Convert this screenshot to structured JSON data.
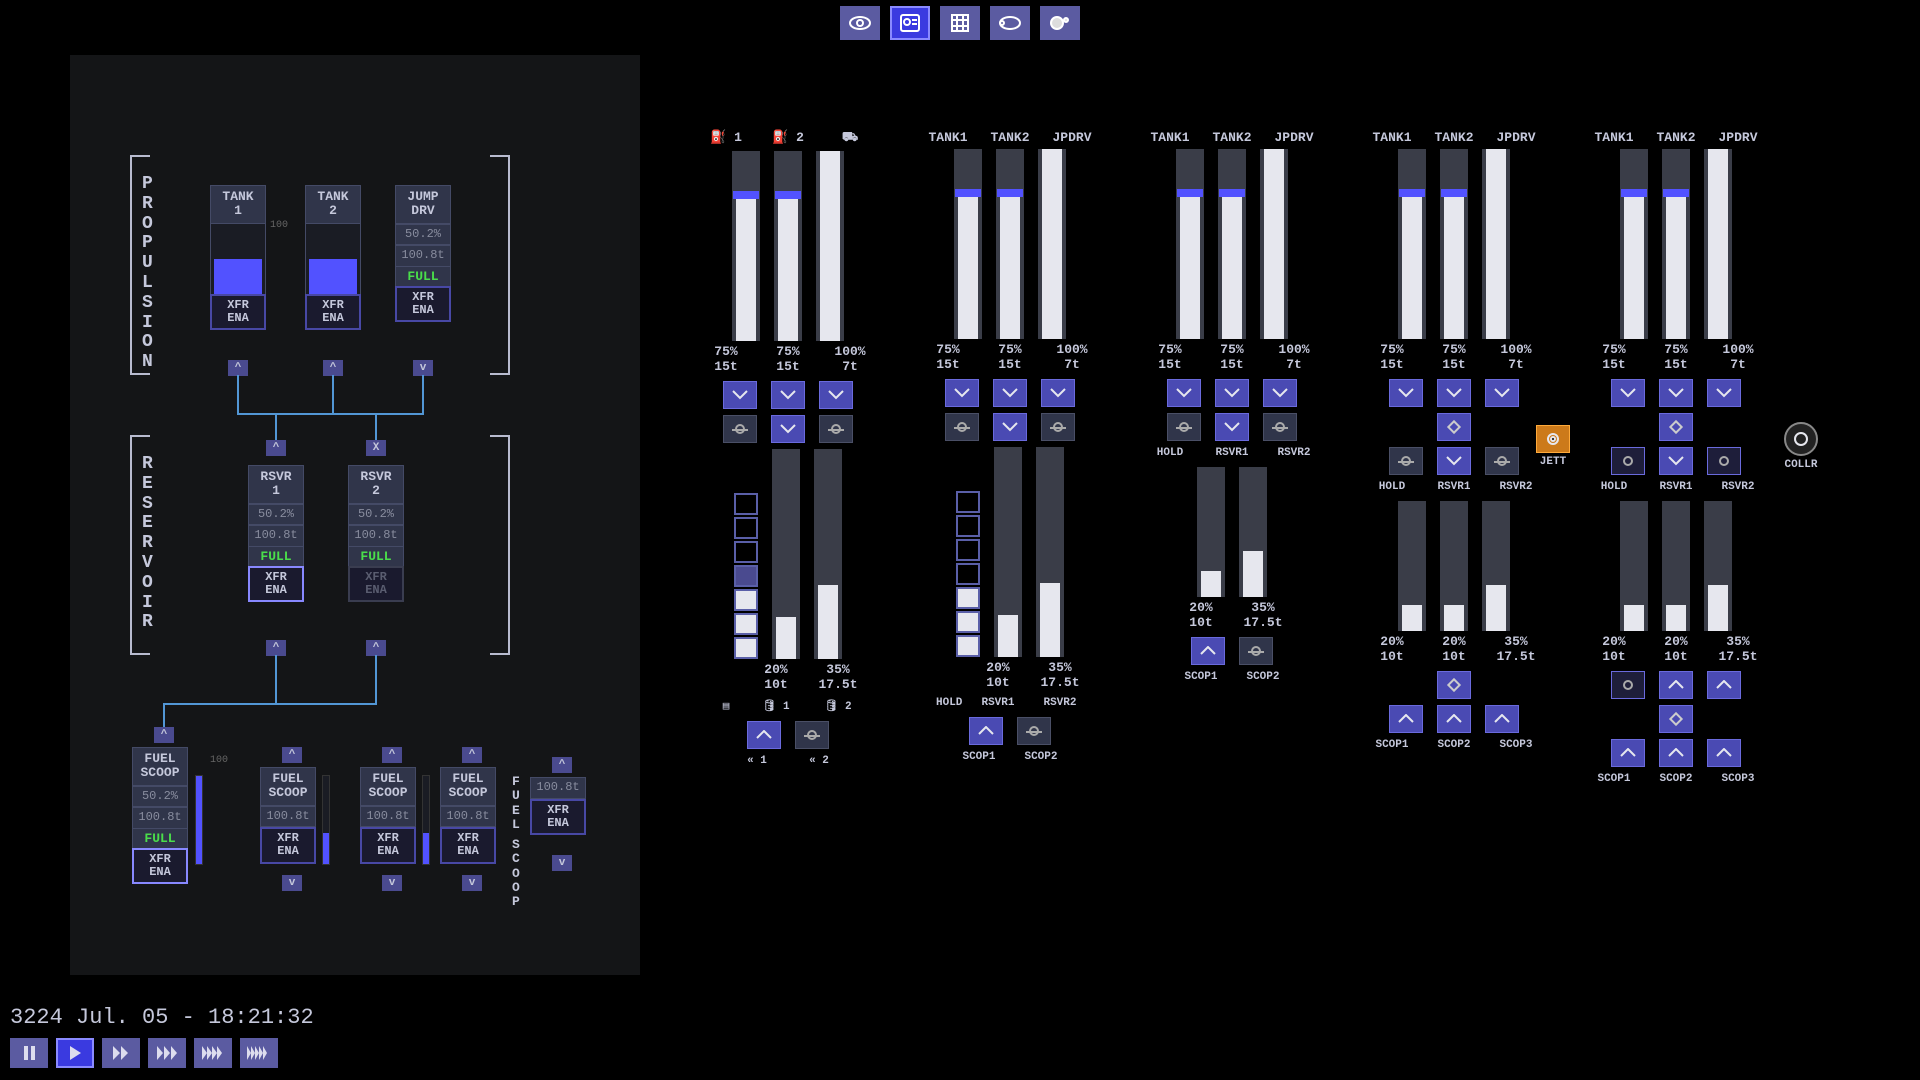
{
  "topnav": [
    {
      "name": "view-icon",
      "active": false,
      "glyph": "eye"
    },
    {
      "name": "profile-icon",
      "active": true,
      "glyph": "id"
    },
    {
      "name": "grid-icon",
      "active": false,
      "glyph": "grid"
    },
    {
      "name": "orbit-icon",
      "active": false,
      "glyph": "orbit"
    },
    {
      "name": "planet-icon",
      "active": false,
      "glyph": "planet"
    }
  ],
  "leftpanel": {
    "propulsion": {
      "label": "PROPULSION",
      "tanks": [
        {
          "title": "TANK\n1",
          "fill": 50,
          "xfr": "XFR\nENA",
          "xfr_highlight": false,
          "show_gauge": true
        },
        {
          "title": "TANK\n2",
          "fill": 50,
          "xfr": "XFR\nENA",
          "xfr_highlight": false,
          "show_gauge": true
        },
        {
          "title": "JUMP\nDRV",
          "fill": 50,
          "xfr": "XFR\nENA",
          "xfr_highlight": false,
          "show_gauge": false,
          "pct": "50.2%",
          "mass": "100.8t",
          "status": "FULL"
        }
      ],
      "arrows": [
        "^",
        "^",
        "v"
      ]
    },
    "reservoir": {
      "label": "RESERVOIR",
      "top_ctrls": [
        "^",
        "X"
      ],
      "tanks": [
        {
          "title": "RSVR\n1",
          "pct": "50.2%",
          "mass": "100.8t",
          "status": "FULL",
          "xfr": "XFR\nENA",
          "xfr_highlight": true
        },
        {
          "title": "RSVR\n2",
          "pct": "50.2%",
          "mass": "100.8t",
          "status": "FULL",
          "xfr": "XFR\nENA",
          "xfr_highlight": false,
          "xfr_dim": true
        }
      ],
      "bottom_ctrls": [
        "^",
        "^"
      ]
    },
    "scoops": {
      "side_label": "SCOOP",
      "items": [
        {
          "title": "FUEL\nSCOOP",
          "pct": "50.2%",
          "mass": "100.8t",
          "status": "FULL",
          "xfr": "XFR\nENA",
          "xfr_highlight": true,
          "gauge": 100,
          "arrow_top": "^",
          "arrow_bot": null,
          "show_stats": true,
          "show_status": true
        },
        {
          "title": "FUEL\nSCOOP",
          "mass": "100.8t",
          "xfr": "XFR\nENA",
          "gauge": 35,
          "arrow_top": "^",
          "arrow_bot": "v",
          "show_stats": false,
          "show_status": false
        },
        {
          "title": "FUEL\nSCOOP",
          "mass": "100.8t",
          "xfr": "XFR\nENA",
          "gauge": 35,
          "arrow_top": "^",
          "arrow_bot": "v",
          "show_stats": false,
          "show_status": false
        },
        {
          "title": "FUEL\nSCOOP",
          "mass": "100.8t",
          "xfr": "XFR\nENA",
          "gauge": 0,
          "arrow_top": "^",
          "arrow_bot": "v",
          "show_stats": false,
          "show_status": false,
          "no_gauge": true
        },
        {
          "title": "",
          "mass": "100.8t",
          "xfr": "XFR\nENA",
          "gauge": 0,
          "arrow_top": "^",
          "arrow_bot": "v",
          "show_stats": false,
          "show_status": false,
          "no_gauge": true,
          "side_vert": true
        }
      ]
    }
  },
  "lanes": [
    {
      "id": "A",
      "head_icons": [
        "tank1-icon",
        "tank2-icon",
        "jpdrv-icon"
      ],
      "head_labels": [
        "1",
        "2",
        ""
      ],
      "tanks": {
        "pct": [
          "75%",
          "75%",
          "100%"
        ],
        "mass": [
          "15t",
          "15t",
          "7t"
        ],
        "fill": [
          75,
          75,
          100
        ]
      },
      "dropbtns": [
        "v",
        "v",
        "v"
      ],
      "valves": [
        "node",
        "v",
        "node"
      ],
      "hold_cells": {
        "total": 7,
        "filled": 3,
        "partial": 1
      },
      "mid": {
        "pct": [
          "",
          "20%",
          "35%"
        ],
        "mass": [
          "",
          "10t",
          "17.5t"
        ],
        "fill": [
          0,
          20,
          35
        ],
        "labels": [
          "",
          "1",
          "2"
        ]
      },
      "scoop_btns": [
        "^",
        "node"
      ],
      "scoop_labels": [
        "1",
        "2"
      ],
      "scoop_icon": "chevrons"
    },
    {
      "id": "B",
      "head_labels": [
        "TANK1",
        "TANK2",
        "JPDRV"
      ],
      "tanks": {
        "pct": [
          "75%",
          "75%",
          "100%"
        ],
        "mass": [
          "15t",
          "15t",
          "7t"
        ],
        "fill": [
          75,
          75,
          100
        ]
      },
      "dropbtns": [
        "v",
        "v",
        "v"
      ],
      "valves": [
        "node",
        "v",
        "node"
      ],
      "hold_cells": {
        "total": 7,
        "filled": 3,
        "partial": 0
      },
      "mid": {
        "pct": [
          "",
          "20%",
          "35%"
        ],
        "mass": [
          "",
          "10t",
          "17.5t"
        ],
        "fill": [
          0,
          20,
          35
        ],
        "labels": [
          "HOLD",
          "RSVR1",
          "RSVR2"
        ]
      },
      "scoop_btns": [
        "^",
        "node"
      ],
      "scoop_labels": [
        "SCOP1",
        "SCOP2"
      ]
    },
    {
      "id": "C",
      "head_labels": [
        "TANK1",
        "TANK2",
        "JPDRV"
      ],
      "tanks": {
        "pct": [
          "75%",
          "75%",
          "100%"
        ],
        "mass": [
          "15t",
          "15t",
          "7t"
        ],
        "fill": [
          75,
          75,
          100
        ]
      },
      "dropbtns": [
        "v",
        "v",
        "v"
      ],
      "valves": [
        "node",
        "v",
        "node"
      ],
      "valve_labels": [
        "HOLD",
        "RSVR1",
        "RSVR2"
      ],
      "mid": {
        "pct": [
          "",
          "20%",
          "35%"
        ],
        "mass": [
          "",
          "10t",
          "17.5t"
        ],
        "fill": [
          0,
          20,
          35
        ],
        "bars": 2,
        "height": "short"
      },
      "scoop_btns": [
        "^",
        "node"
      ],
      "scoop_labels": [
        "SCOP1",
        "SCOP2"
      ]
    },
    {
      "id": "D",
      "head_labels": [
        "TANK1",
        "TANK2",
        "JPDRV"
      ],
      "tanks": {
        "pct": [
          "75%",
          "75%",
          "100%"
        ],
        "mass": [
          "15t",
          "15t",
          "7t"
        ],
        "fill": [
          75,
          75,
          100
        ]
      },
      "dropbtns": [
        "v",
        "v",
        "v"
      ],
      "hub_top": true,
      "valves": [
        "node",
        "v",
        "node"
      ],
      "valve_labels": [
        "HOLD",
        "RSVR1",
        "RSVR2"
      ],
      "mid": {
        "pct": [
          "20%",
          "20%",
          "35%"
        ],
        "mass": [
          "10t",
          "10t",
          "17.5t"
        ],
        "fill": [
          20,
          20,
          35
        ],
        "bars": 3,
        "height": "short"
      },
      "hub_bot": true,
      "scoop_btns": [
        "^",
        "^",
        "^"
      ],
      "scoop_labels": [
        "SCOP1",
        "SCOP2",
        "SCOP3"
      ]
    },
    {
      "id": "E",
      "head_labels": [
        "TANK1",
        "TANK2",
        "JPDRV"
      ],
      "tanks": {
        "pct": [
          "75%",
          "75%",
          "100%"
        ],
        "mass": [
          "15t",
          "15t",
          "7t"
        ],
        "fill": [
          75,
          75,
          100
        ]
      },
      "dropbtns": [
        "v",
        "v",
        "v"
      ],
      "side_left": {
        "label": "JETT",
        "style": "orange"
      },
      "side_right": {
        "label": "COLLR",
        "style": "circle"
      },
      "hub_top": true,
      "valves": [
        "circ",
        "v",
        "circ"
      ],
      "valve_labels": [
        "HOLD",
        "RSVR1",
        "RSVR2"
      ],
      "mid": {
        "pct": [
          "20%",
          "20%",
          "35%"
        ],
        "mass": [
          "10t",
          "10t",
          "17.5t"
        ],
        "fill": [
          20,
          20,
          35
        ],
        "bars": 3,
        "height": "short"
      },
      "extra_row": [
        "circ",
        "^",
        "^"
      ],
      "hub_bot": true,
      "scoop_btns": [
        "^",
        "^",
        "^"
      ],
      "scoop_labels": [
        "SCOP1",
        "SCOP2",
        "SCOP3"
      ]
    }
  ],
  "footer": {
    "clock": "3224 Jul. 05 - 18:21:32",
    "buttons": [
      "pause",
      "play",
      "ff1",
      "ff2",
      "ff3",
      "ff4"
    ],
    "active": "play"
  }
}
